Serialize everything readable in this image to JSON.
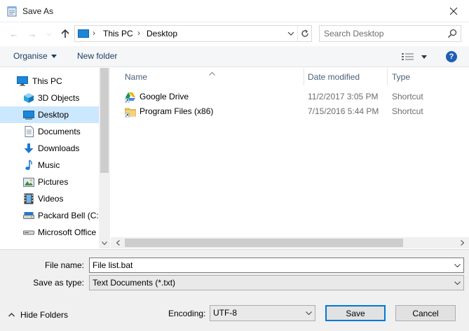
{
  "window": {
    "title": "Save As"
  },
  "address": {
    "crumbs": [
      "This PC",
      "Desktop"
    ]
  },
  "search": {
    "placeholder": "Search Desktop"
  },
  "toolbar": {
    "organise_label": "Organise",
    "new_folder_label": "New folder",
    "help_label": "?"
  },
  "nav": {
    "items": [
      {
        "label": "This PC",
        "icon": "computer-icon",
        "selected": false
      },
      {
        "label": "3D Objects",
        "icon": "cube-icon",
        "selected": false
      },
      {
        "label": "Desktop",
        "icon": "desktop-icon",
        "selected": true
      },
      {
        "label": "Documents",
        "icon": "document-icon",
        "selected": false
      },
      {
        "label": "Downloads",
        "icon": "download-arrow-icon",
        "selected": false
      },
      {
        "label": "Music",
        "icon": "music-note-icon",
        "selected": false
      },
      {
        "label": "Pictures",
        "icon": "picture-icon",
        "selected": false
      },
      {
        "label": "Videos",
        "icon": "film-icon",
        "selected": false
      },
      {
        "label": "Packard Bell (C:)",
        "icon": "drive-icon",
        "selected": false
      },
      {
        "label": "Microsoft Office",
        "icon": "drive-icon",
        "selected": false
      }
    ]
  },
  "files": {
    "columns": [
      "Name",
      "Date modified",
      "Type"
    ],
    "rows": [
      {
        "name": "Google Drive",
        "date": "11/2/2017 3:05 PM",
        "type": "Shortcut",
        "icon": "google-drive-shortcut-icon"
      },
      {
        "name": "Program Files (x86)",
        "date": "7/15/2016 5:44 PM",
        "type": "Shortcut",
        "icon": "folder-shortcut-icon"
      }
    ]
  },
  "form": {
    "file_name_label": "File name:",
    "file_name_value": "File list.bat",
    "save_type_label": "Save as type:",
    "save_type_value": "Text Documents (*.txt)",
    "encoding_label": "Encoding:",
    "encoding_value": "UTF-8"
  },
  "buttons": {
    "hide_folders": "Hide Folders",
    "save": "Save",
    "cancel": "Cancel"
  },
  "colors": {
    "selection": "#cce8ff",
    "accent": "#0078d7",
    "link": "#1a3d63"
  }
}
